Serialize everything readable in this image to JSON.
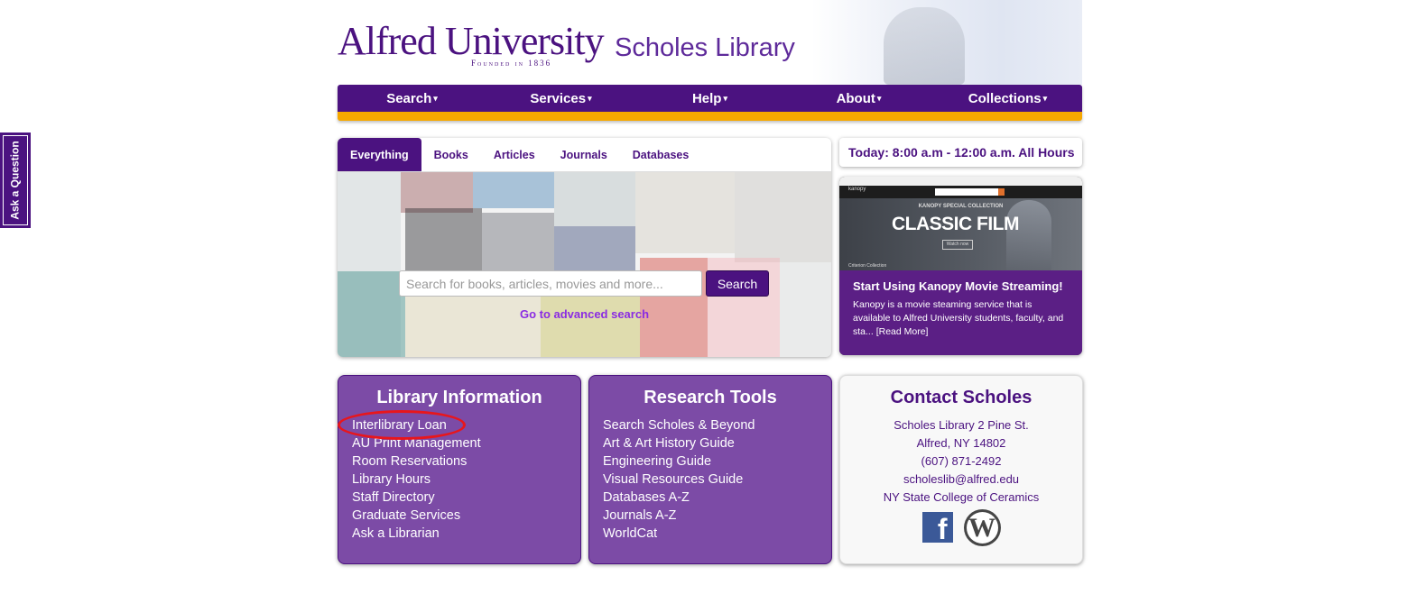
{
  "side_tab": {
    "label": "Ask a Question"
  },
  "header": {
    "university": "Alfred University",
    "founded": "Founded in 1836",
    "library": "Scholes Library"
  },
  "nav": {
    "caret": "▾",
    "items": [
      "Search",
      "Services",
      "Help",
      "About",
      "Collections"
    ]
  },
  "search": {
    "tabs": [
      "Everything",
      "Books",
      "Articles",
      "Journals",
      "Databases"
    ],
    "active_tab": "Everything",
    "placeholder": "Search for books, articles, movies and more...",
    "button": "Search",
    "advanced_link": "Go to advanced search"
  },
  "hours": {
    "text": "Today: 8:00 a.m - 12:00 a.m. All Hours"
  },
  "feature": {
    "screenshot": {
      "brand": "kanopy",
      "special": "KANOPY SPECIAL COLLECTION",
      "headline": "CLASSIC FILM",
      "watch": "Watch now",
      "collection": "Criterion Collection"
    },
    "title": "Start Using Kanopy Movie Streaming!",
    "description": "Kanopy is a movie steaming service that is available to Alfred University students, faculty, and sta...",
    "read_more": "[Read More]"
  },
  "library_info": {
    "title": "Library Information",
    "links": [
      "Interlibrary Loan",
      "AU Print Management",
      "Room Reservations",
      "Library Hours",
      "Staff Directory",
      "Graduate Services",
      "Ask a Librarian"
    ]
  },
  "research_tools": {
    "title": "Research Tools",
    "links": [
      "Search Scholes & Beyond",
      "Art & Art History Guide",
      "Engineering Guide",
      "Visual Resources Guide",
      "Databases A-Z",
      "Journals A-Z",
      "WorldCat"
    ]
  },
  "contact": {
    "title": "Contact Scholes",
    "lines": [
      "Scholes Library 2 Pine St.",
      "Alfred, NY 14802",
      "(607) 871-2492",
      "scholeslib@alfred.edu",
      "NY State College of Ceramics"
    ],
    "facebook_glyph": "f",
    "wordpress_glyph": "W"
  },
  "colors": {
    "brand_purple": "#4b1280",
    "accent_gold": "#f6a800",
    "box_purple": "#7c4ba6",
    "annotation_red": "#e8161c"
  }
}
